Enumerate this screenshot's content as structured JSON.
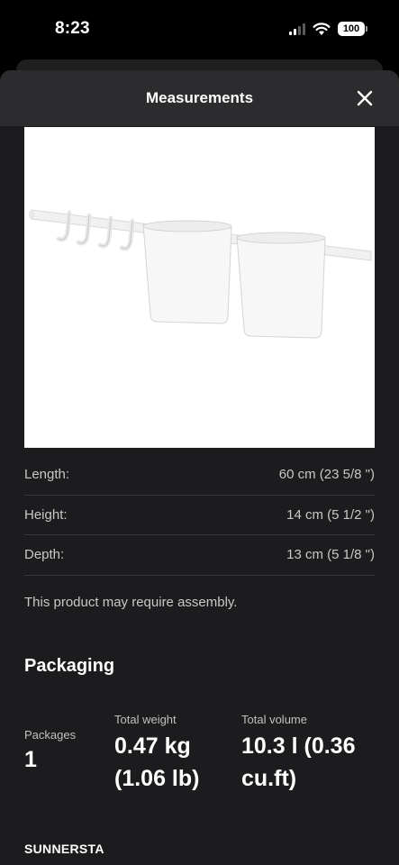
{
  "status_bar": {
    "time": "8:23",
    "battery": "100"
  },
  "sheet": {
    "title": "Measurements"
  },
  "dimensions": [
    {
      "label": "Length:",
      "value": "60 cm (23 5/8 \")"
    },
    {
      "label": "Height:",
      "value": "14 cm (5 1/2 \")"
    },
    {
      "label": "Depth:",
      "value": "13 cm (5 1/8 \")"
    }
  ],
  "assembly_note": "This product may require assembly.",
  "packaging": {
    "title": "Packaging",
    "packages_label": "Packages",
    "packages_value": "1",
    "weight_label": "Total weight",
    "weight_value_line1": "0.47 kg",
    "weight_value_line2": "(1.06 lb)",
    "volume_label": "Total volume",
    "volume_value_line1": "10.3 l (0.36",
    "volume_value_line2": "cu.ft)"
  },
  "section_name": "SUNNERSTA",
  "colors": {
    "sheet_bg": "#1c1c1e",
    "header_bg": "#2c2c2e",
    "divider": "#38383a"
  }
}
